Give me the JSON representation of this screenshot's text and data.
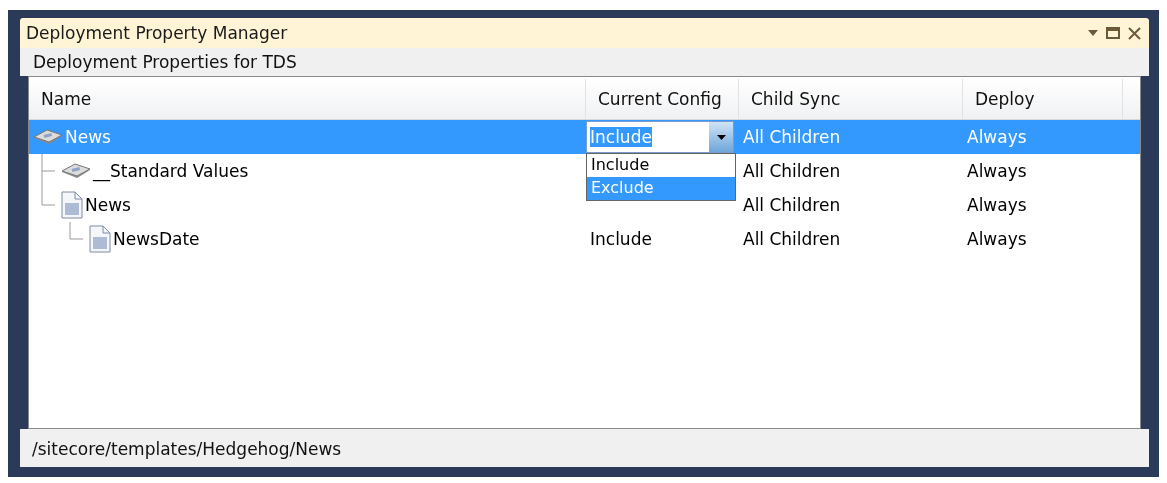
{
  "window": {
    "title": "Deployment Property Manager"
  },
  "subtitle": "Deployment Properties for TDS",
  "table": {
    "columns": [
      "Name",
      "Current Config",
      "Child Sync",
      "Deploy"
    ],
    "rows": [
      {
        "name": "News",
        "kind": "template",
        "selected": true,
        "config": "Include",
        "child_sync": "All Children",
        "deploy": "Always",
        "children": [
          {
            "name": "__Standard Values",
            "kind": "template",
            "selected": false,
            "child_sync": "All Children",
            "deploy": "Always"
          },
          {
            "name": "News",
            "kind": "item",
            "selected": false,
            "child_sync": "All Children",
            "deploy": "Always",
            "children": [
              {
                "name": "NewsDate",
                "kind": "item",
                "selected": false,
                "config": "Include",
                "child_sync": "All Children",
                "deploy": "Always"
              }
            ]
          }
        ]
      }
    ]
  },
  "config_dropdown": {
    "options": [
      {
        "label": "Include",
        "selected": false
      },
      {
        "label": "Exclude",
        "selected": true
      }
    ]
  },
  "status_bar": "/sitecore/templates/Hedgehog/News"
}
